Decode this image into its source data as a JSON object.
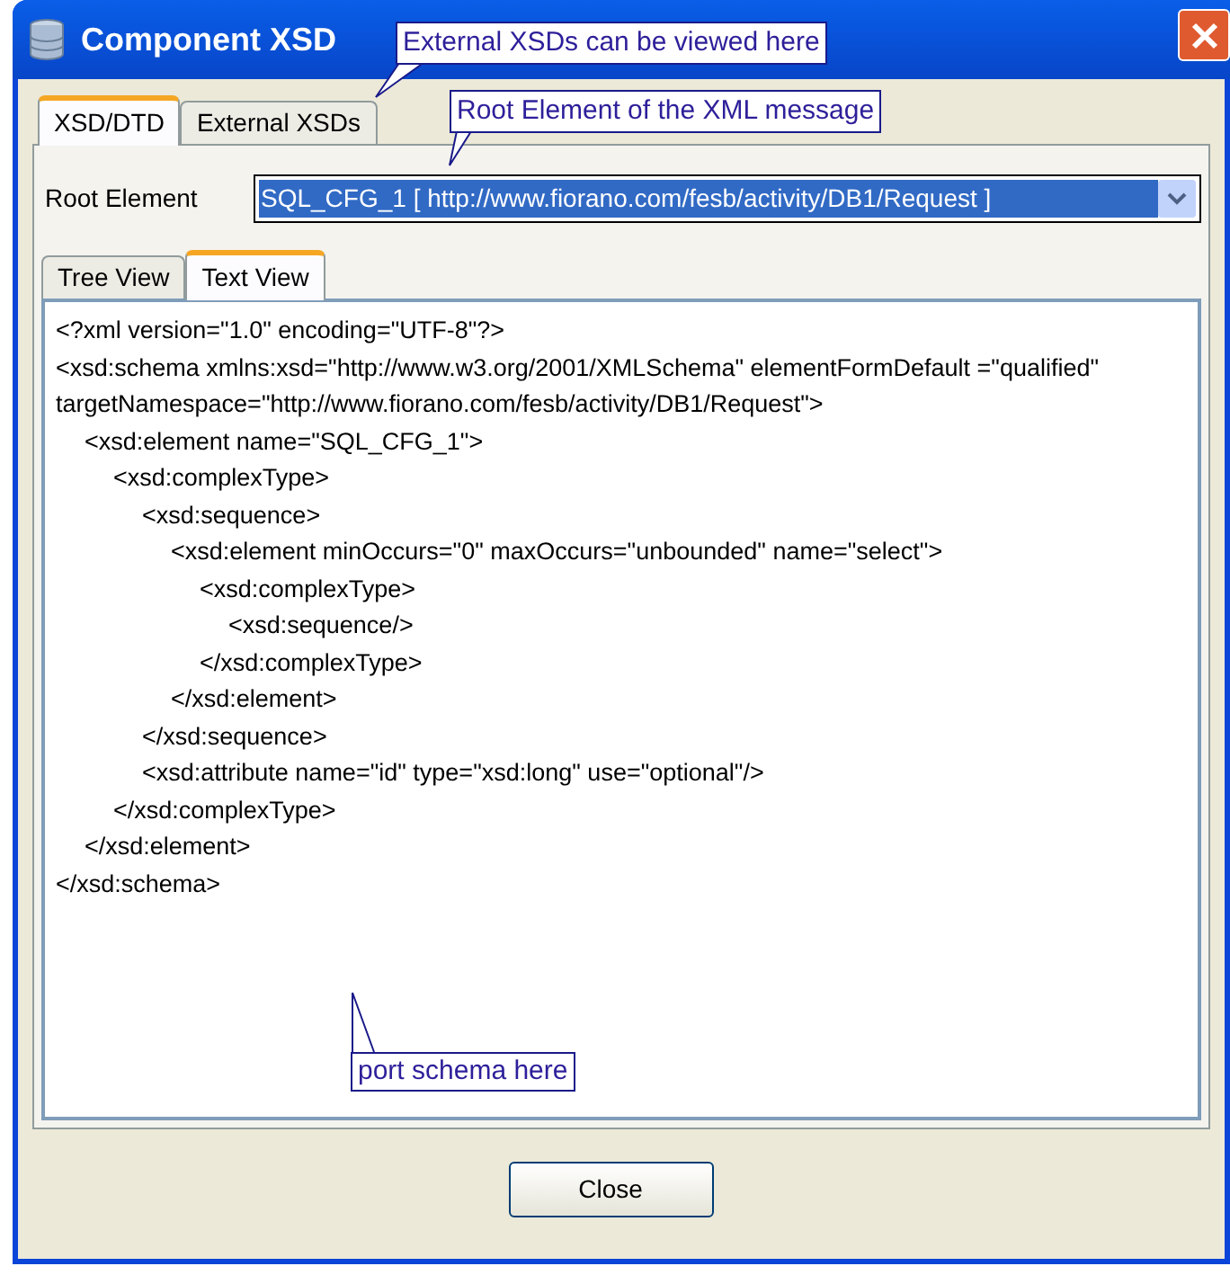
{
  "window": {
    "title": "Component XSD"
  },
  "tabs": [
    {
      "label": "XSD/DTD",
      "selected": true
    },
    {
      "label": "External XSDs",
      "selected": false
    }
  ],
  "root_element": {
    "label": "Root Element",
    "value": "SQL_CFG_1 [ http://www.fiorano.com/fesb/activity/DB1/Request ]"
  },
  "view_tabs": [
    {
      "label": "Tree View",
      "selected": false
    },
    {
      "label": "Text View",
      "selected": true
    }
  ],
  "text_view": {
    "lines": [
      {
        "text": "<?xml version=\"1.0\" encoding=\"UTF-8\"?>"
      },
      {
        "text": "<xsd:schema xmlns:xsd=\"http://www.w3.org/2001/XMLSchema\" elementFormDefault =\"qualified\" targetNamespace=\"http://www.fiorano.com/fesb/activity/DB1/Request\">",
        "children": [
          {
            "text": "<xsd:element name=\"SQL_CFG_1\">",
            "children": [
              {
                "text": "<xsd:complexType>",
                "children": [
                  {
                    "text": "<xsd:sequence>",
                    "children": [
                      {
                        "text": "<xsd:element minOccurs=\"0\" maxOccurs=\"unbounded\" name=\"select\">",
                        "children": [
                          {
                            "text": "<xsd:complexType>",
                            "children": [
                              {
                                "text": "<xsd:sequence/>"
                              }
                            ]
                          },
                          {
                            "text": "</xsd:complexType>"
                          }
                        ]
                      },
                      {
                        "text": "</xsd:element>"
                      }
                    ]
                  },
                  {
                    "text": "</xsd:sequence>"
                  },
                  {
                    "text": "<xsd:attribute name=\"id\" type=\"xsd:long\" use=\"optional\"/>"
                  }
                ]
              },
              {
                "text": "</xsd:complexType>"
              }
            ]
          },
          {
            "text": "</xsd:element>"
          }
        ]
      },
      {
        "text": "</xsd:schema>"
      }
    ]
  },
  "callouts": [
    {
      "text": "External XSDs can be viewed here"
    },
    {
      "text": "Root Element of the XML message"
    },
    {
      "text": "port schema here"
    }
  ],
  "buttons": [
    {
      "label": "Close"
    }
  ]
}
